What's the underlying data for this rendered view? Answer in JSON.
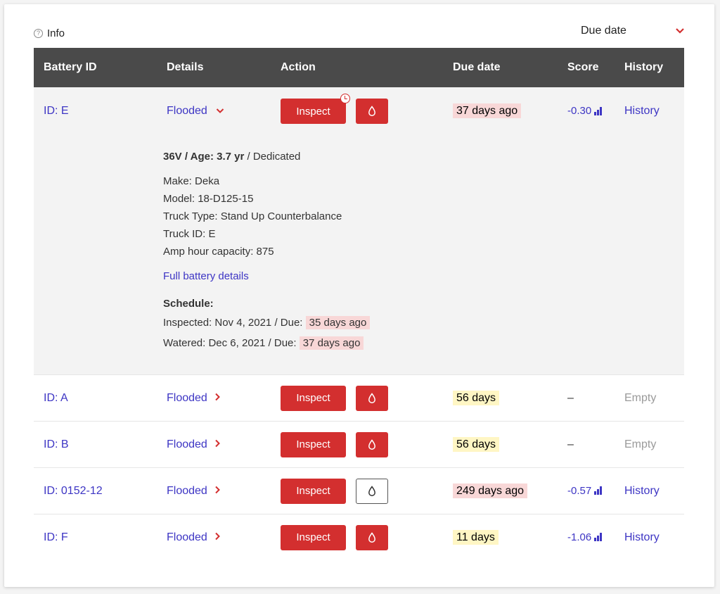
{
  "info_label": "Info",
  "sort": {
    "label": "Due date"
  },
  "columns": [
    "Battery ID",
    "Details",
    "Action",
    "Due date",
    "Score",
    "History"
  ],
  "colors": {
    "accent": "#d32f2f",
    "link": "#3d35c4",
    "header": "#4a4a4a",
    "due_red_bg": "#f8d7d7",
    "due_yellow_bg": "#fff6c4"
  },
  "expanded": {
    "id": "ID: E",
    "type": "Flooded",
    "inspect_label": "Inspect",
    "due": "37 days ago",
    "score": "-0.30",
    "history": "History",
    "summary_bold": "36V / Age: 3.7 yr",
    "summary_rest": " / Dedicated",
    "make": "Make: Deka",
    "model": "Model: 18-D125-15",
    "truck_type": "Truck Type: Stand Up Counterbalance",
    "truck_id": "Truck ID: E",
    "amp": "Amp hour capacity: 875",
    "full_link": "Full battery details",
    "schedule_title": "Schedule:",
    "inspected_prefix": "Inspected: Nov 4, 2021 / Due:",
    "inspected_due": "35 days ago",
    "watered_prefix": "Watered: Dec 6, 2021 / Due:",
    "watered_due": "37 days ago"
  },
  "rows": [
    {
      "id": "ID: A",
      "type": "Flooded",
      "inspect_label": "Inspect",
      "due": "56 days",
      "score": "–",
      "history": "Empty"
    },
    {
      "id": "ID: B",
      "type": "Flooded",
      "inspect_label": "Inspect",
      "due": "56 days",
      "score": "–",
      "history": "Empty"
    },
    {
      "id": "ID: 0152-12",
      "type": "Flooded",
      "inspect_label": "Inspect",
      "due": "249 days ago",
      "score": "-0.57",
      "history": "History"
    },
    {
      "id": "ID: F",
      "type": "Flooded",
      "inspect_label": "Inspect",
      "due": "11 days",
      "score": "-1.06",
      "history": "History"
    }
  ]
}
